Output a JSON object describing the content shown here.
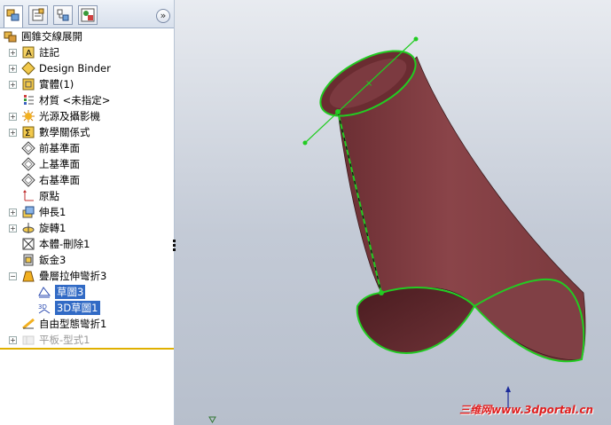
{
  "tabs": [
    {
      "name": "FeatureManager"
    },
    {
      "name": "PropertyManager"
    },
    {
      "name": "ConfigurationManager"
    },
    {
      "name": "DisplayManager"
    }
  ],
  "expand_glyph": "»",
  "tree": {
    "root": "圓錐交線展開",
    "items": [
      {
        "label": "註記",
        "icon": "annotation-icon",
        "expand": "+"
      },
      {
        "label": "Design Binder",
        "icon": "design-binder-icon",
        "expand": "+"
      },
      {
        "label": "實體(1)",
        "icon": "solid-bodies-icon",
        "expand": "+"
      },
      {
        "label": "材質 <未指定>",
        "icon": "material-icon",
        "expand": ""
      },
      {
        "label": "光源及攝影機",
        "icon": "lights-cameras-icon",
        "expand": "+"
      },
      {
        "label": "數學關係式",
        "icon": "equations-icon",
        "expand": "+"
      },
      {
        "label": "前基準面",
        "icon": "plane-icon",
        "expand": ""
      },
      {
        "label": "上基準面",
        "icon": "plane-icon",
        "expand": ""
      },
      {
        "label": "右基準面",
        "icon": "plane-icon",
        "expand": ""
      },
      {
        "label": "原點",
        "icon": "origin-icon",
        "expand": ""
      },
      {
        "label": "伸長1",
        "icon": "extrude-icon",
        "expand": "+"
      },
      {
        "label": "旋轉1",
        "icon": "revolve-icon",
        "expand": "+"
      },
      {
        "label": "本體-刪除1",
        "icon": "body-delete-icon",
        "expand": ""
      },
      {
        "label": "鈑金3",
        "icon": "sheet-metal-icon",
        "expand": ""
      },
      {
        "label": "疊層拉伸彎折3",
        "icon": "lofted-bend-icon",
        "expand": "−"
      },
      {
        "label": "草圖3",
        "icon": "sketch-icon",
        "expand": "",
        "child": true,
        "selected": true
      },
      {
        "label": "3D草圖1",
        "icon": "3d-sketch-icon",
        "expand": "",
        "child": true,
        "selected": true
      },
      {
        "label": "自由型態彎折1",
        "icon": "free-bend-icon",
        "expand": ""
      },
      {
        "label": "平板-型式1",
        "icon": "flat-pattern-icon",
        "expand": "+",
        "disabled": true
      }
    ]
  },
  "watermark": "三维网www.3dportal.cn",
  "colors": {
    "model_fill": "#7a3a3e",
    "edge_highlight": "#22cc22",
    "selection": "#316ac5",
    "splitter": "#e0b000"
  }
}
